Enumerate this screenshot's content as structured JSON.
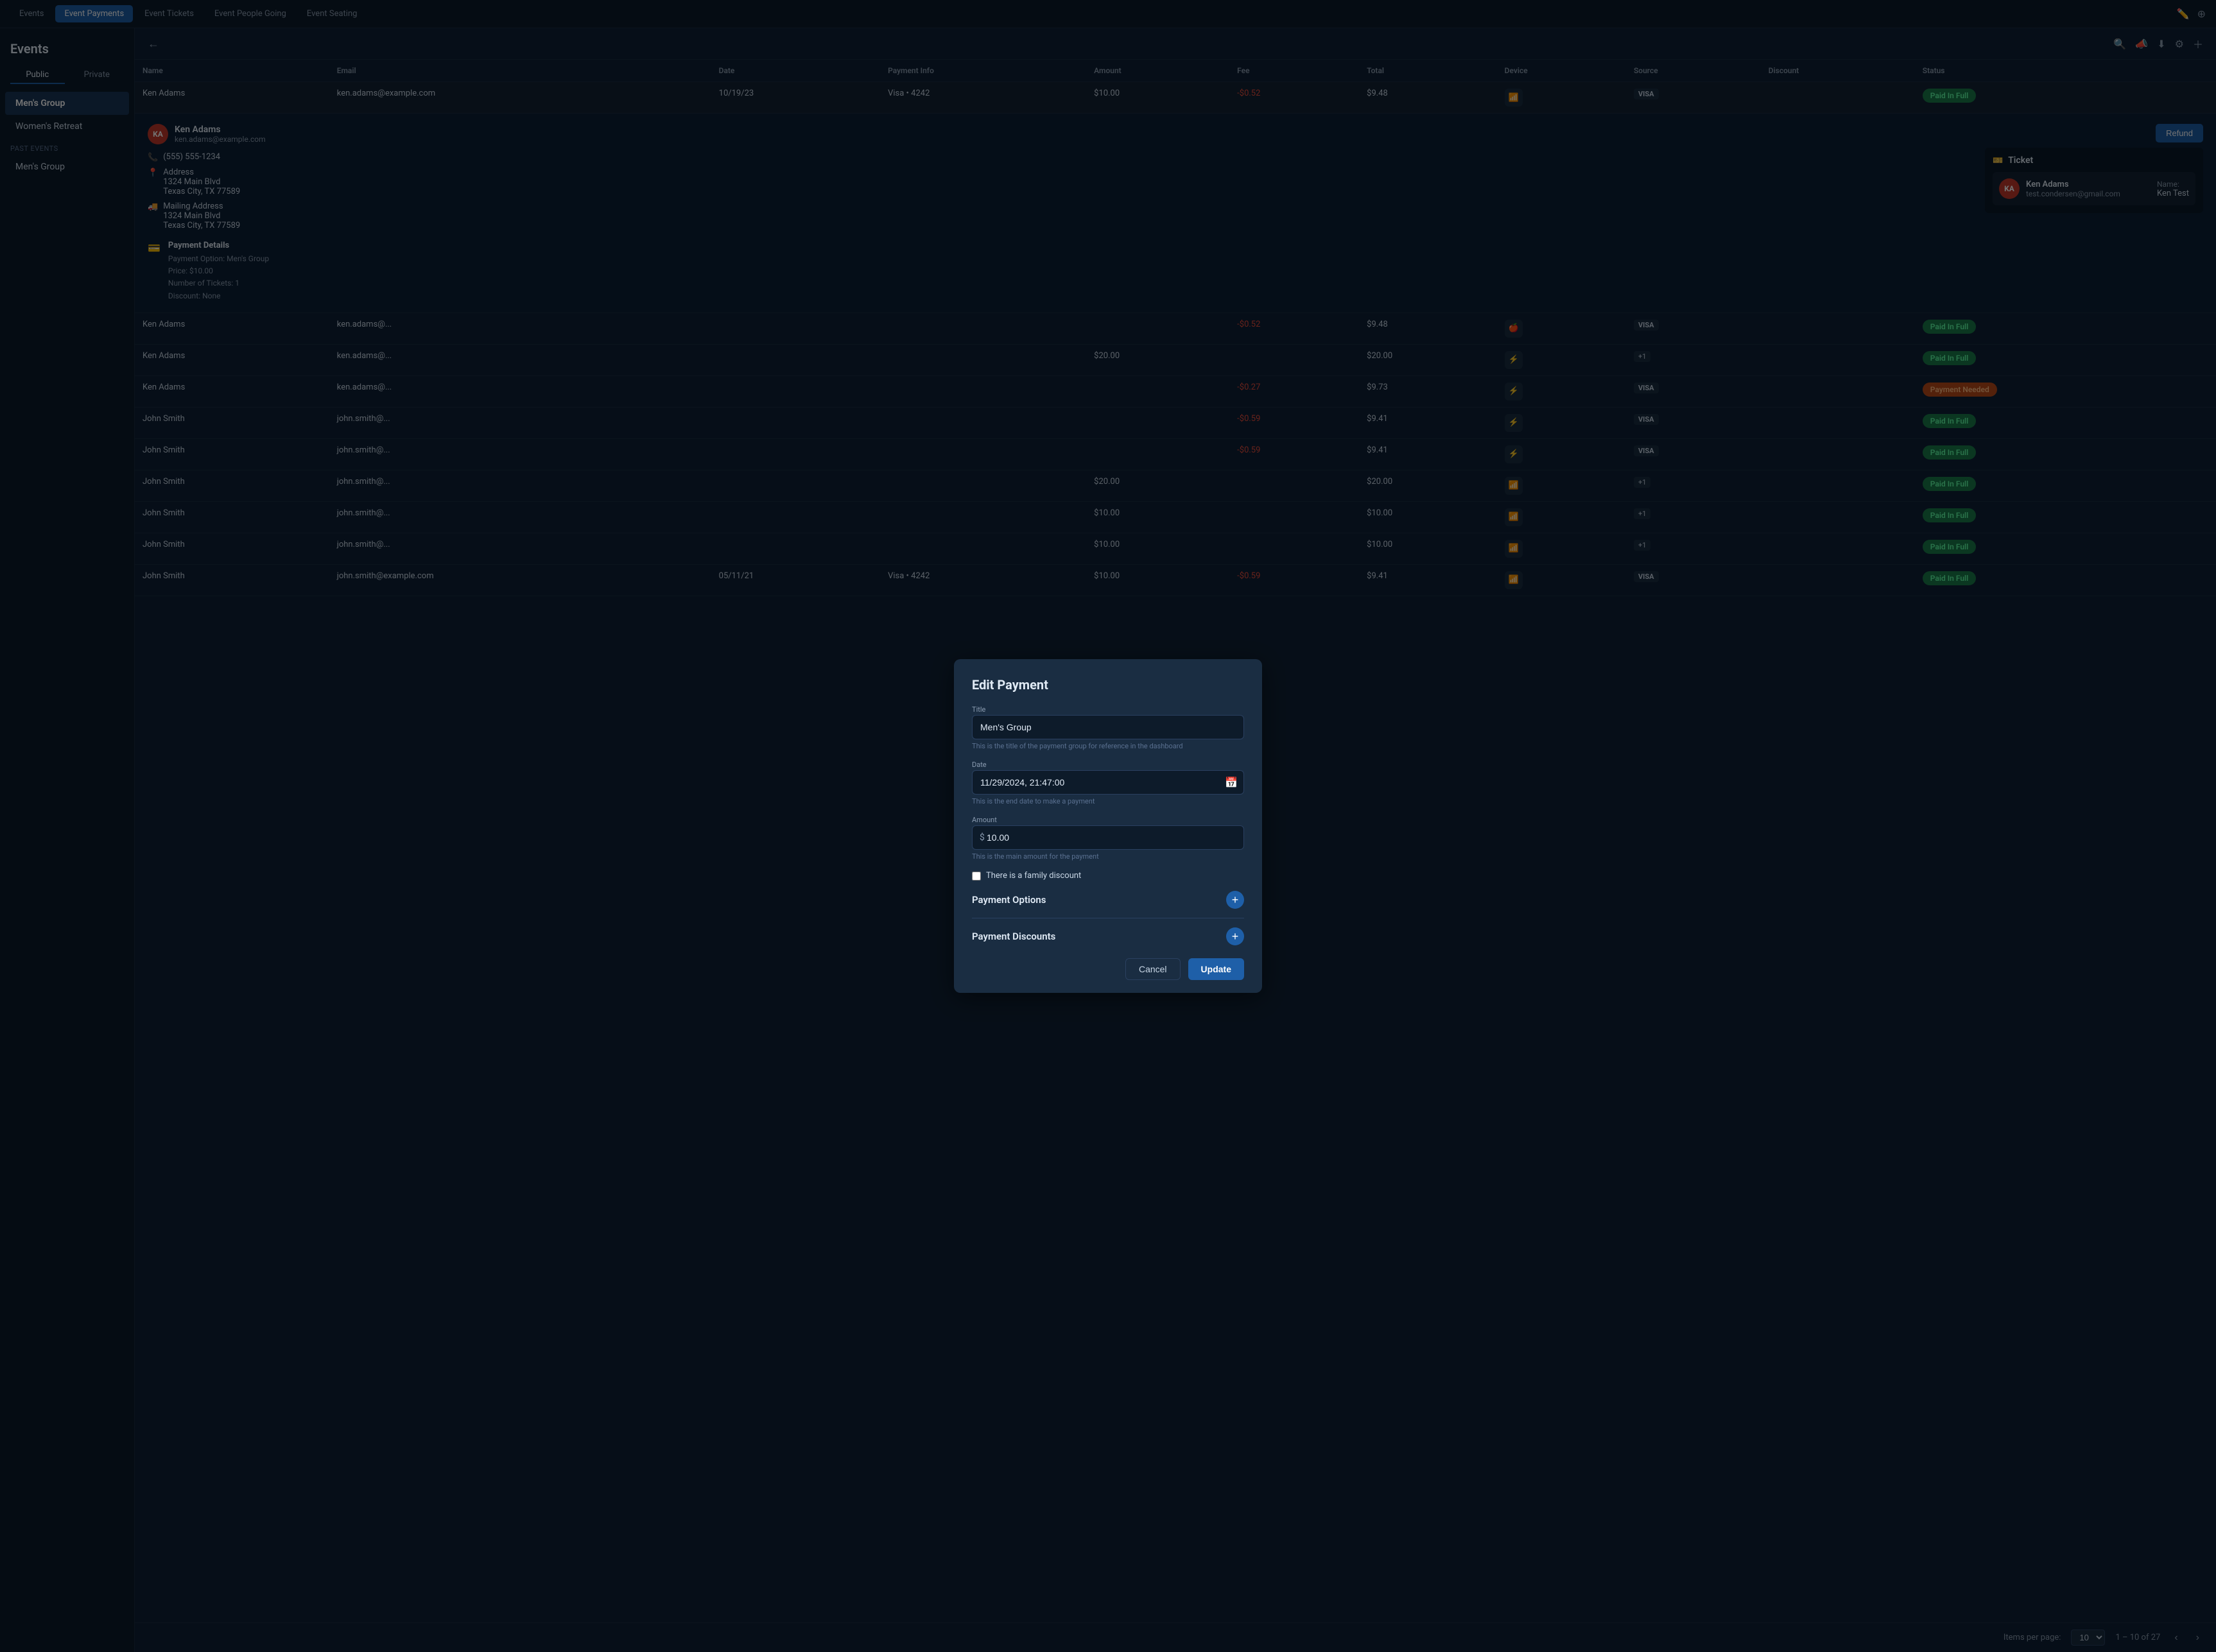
{
  "topNav": {
    "items": [
      {
        "label": "Events",
        "active": false
      },
      {
        "label": "Event Payments",
        "active": true
      },
      {
        "label": "Event Tickets",
        "active": false
      },
      {
        "label": "Event People Going",
        "active": false
      },
      {
        "label": "Event Seating",
        "active": false
      }
    ],
    "icons": [
      "edit-icon",
      "plus-circle-icon"
    ]
  },
  "sidebar": {
    "title": "Events",
    "tabs": [
      "Public",
      "Private"
    ],
    "activeTab": "Public",
    "items": [
      {
        "label": "Men's Group",
        "active": true
      },
      {
        "label": "Women's Retreat",
        "active": false
      }
    ],
    "pastEventsLabel": "Past Events",
    "pastItems": [
      {
        "label": "Men's Group",
        "active": false
      }
    ]
  },
  "contentHeader": {
    "backIcon": "←",
    "icons": [
      "search-icon",
      "megaphone-icon",
      "download-icon",
      "filter-icon",
      "plus-icon"
    ]
  },
  "table": {
    "columns": [
      "Name",
      "Email",
      "Date",
      "Payment Info",
      "Amount",
      "Fee",
      "Total",
      "Device",
      "Source",
      "Discount",
      "Status"
    ],
    "rows": [
      {
        "name": "Ken Adams",
        "email": "ken.adams@example.com",
        "date": "10/19/23",
        "paymentInfo": "Visa • 4242",
        "amount": "$10.00",
        "fee": "-$0.52",
        "total": "$9.48",
        "device": "wifi",
        "source": "visa",
        "discount": "",
        "status": "Paid In Full",
        "statusType": "paid",
        "expanded": true
      },
      {
        "name": "Ken Adams",
        "email": "ken.adams@...",
        "date": "",
        "paymentInfo": "",
        "amount": "",
        "fee": "-$0.52",
        "total": "$9.48",
        "device": "apple",
        "source": "visa",
        "discount": "",
        "status": "Paid In Full",
        "statusType": "paid",
        "expanded": false
      },
      {
        "name": "Ken Adams",
        "email": "ken.adams@...",
        "date": "",
        "paymentInfo": "",
        "amount": "$20.00",
        "fee": "",
        "total": "$20.00",
        "device": "duo",
        "source": "+1",
        "discount": "",
        "status": "Paid In Full",
        "statusType": "paid",
        "expanded": false
      },
      {
        "name": "Ken Adams",
        "email": "ken.adams@...",
        "date": "",
        "paymentInfo": "",
        "amount": "",
        "fee": "-$0.27",
        "total": "$9.73",
        "device": "duo",
        "source": "visa",
        "discount": "",
        "status": "Payment Needed",
        "statusType": "needed",
        "expanded": false
      },
      {
        "name": "John Smith",
        "email": "john.smith@...",
        "date": "",
        "paymentInfo": "",
        "amount": "",
        "fee": "-$0.59",
        "total": "$9.41",
        "device": "duo",
        "source": "visa",
        "discount": "",
        "status": "Paid In Full",
        "statusType": "paid",
        "expanded": false
      },
      {
        "name": "John Smith",
        "email": "john.smith@...",
        "date": "",
        "paymentInfo": "",
        "amount": "",
        "fee": "-$0.59",
        "total": "$9.41",
        "device": "duo",
        "source": "visa",
        "discount": "",
        "status": "Paid In Full",
        "statusType": "paid",
        "expanded": false
      },
      {
        "name": "John Smith",
        "email": "john.smith@...",
        "date": "",
        "paymentInfo": "",
        "amount": "$20.00",
        "fee": "",
        "total": "$20.00",
        "device": "wifi",
        "source": "+1",
        "discount": "",
        "status": "Paid In Full",
        "statusType": "paid",
        "expanded": false
      },
      {
        "name": "John Smith",
        "email": "john.smith@...",
        "date": "",
        "paymentInfo": "",
        "amount": "$10.00",
        "fee": "",
        "total": "$10.00",
        "device": "wifi",
        "source": "+1",
        "discount": "",
        "status": "Paid In Full",
        "statusType": "paid",
        "expanded": false
      },
      {
        "name": "John Smith",
        "email": "john.smith@...",
        "date": "",
        "paymentInfo": "",
        "amount": "$10.00",
        "fee": "",
        "total": "$10.00",
        "device": "wifi",
        "source": "+1",
        "discount": "",
        "status": "Paid In Full",
        "statusType": "paid",
        "expanded": false
      },
      {
        "name": "John Smith",
        "email": "john.smith@example.com",
        "date": "05/11/21",
        "paymentInfo": "Visa • 4242",
        "amount": "$10.00",
        "fee": "-$0.59",
        "total": "$9.41",
        "device": "wifi",
        "source": "visa",
        "discount": "",
        "status": "Paid In Full",
        "statusType": "paid",
        "expanded": false
      }
    ]
  },
  "expandedRow": {
    "avatar": "KA",
    "name": "Ken Adams",
    "email": "ken.adams@example.com",
    "phone": "(555) 555-1234",
    "address": "Address\n1324 Main Blvd\nTexas City, TX 77589",
    "mailingAddress": "Mailing Address\n1324 Main Blvd\nTexas City, TX 77589",
    "paymentDetails": {
      "title": "Payment Details",
      "option": "Payment Option: Men's Group",
      "price": "Price: $10.00",
      "tickets": "Number of Tickets: 1",
      "discount": "Discount: None"
    },
    "ticket": {
      "title": "Ticket",
      "person": {
        "avatar": "KA",
        "name": "Ken Adams",
        "email": "test.condersen@gmail.com",
        "nameLabel": "Name:",
        "nameValue": "Ken Test"
      }
    },
    "refundLabel": "Refund"
  },
  "modal": {
    "title": "Edit Payment",
    "titleFieldLabel": "Title",
    "titleFieldValue": "Men's Group",
    "titleFieldHint": "This is the title of the payment group for reference in the dashboard",
    "dateFieldLabel": "Date",
    "dateFieldValue": "11/29/2024, 21:47:00",
    "dateFieldHint": "This is the end date to make a payment",
    "amountFieldLabel": "Amount",
    "amountFieldPrefix": "$",
    "amountFieldValue": "10.00",
    "amountFieldHint": "This is the main amount for the payment",
    "familyDiscountLabel": "There is a family discount",
    "paymentOptionsLabel": "Payment Options",
    "paymentDiscountsLabel": "Payment Discounts",
    "cancelLabel": "Cancel",
    "updateLabel": "Update"
  },
  "pagination": {
    "itemsPerPageLabel": "Items per page:",
    "itemsPerPage": "10",
    "rangeText": "1 – 10 of 27"
  }
}
